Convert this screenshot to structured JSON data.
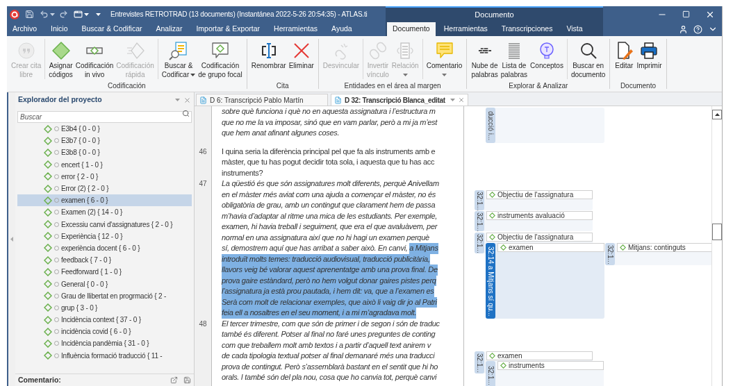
{
  "title_bar": {
    "title": "Entrevistes RETROTRAD (13 documents) (Instantánea 2022-5-26 20:54:35) - ATLAS.ti",
    "context_label": "Documento"
  },
  "menu_tabs": [
    {
      "label": "Archivo",
      "selected": false,
      "kind": "main"
    },
    {
      "label": "Inicio",
      "selected": false,
      "kind": "main"
    },
    {
      "label": "Buscar & Codificar",
      "selected": false,
      "kind": "main"
    },
    {
      "label": "Analizar",
      "selected": false,
      "kind": "main"
    },
    {
      "label": "Importar & Exportar",
      "selected": false,
      "kind": "main"
    },
    {
      "label": "Herramientas",
      "selected": false,
      "kind": "main"
    },
    {
      "label": "Ayuda",
      "selected": false,
      "kind": "main"
    },
    {
      "label": "Documento",
      "selected": true,
      "kind": "context"
    },
    {
      "label": "Herramientas",
      "selected": false,
      "kind": "context"
    },
    {
      "label": "Transcripciones",
      "selected": false,
      "kind": "context"
    },
    {
      "label": "Vista",
      "selected": false,
      "kind": "context"
    }
  ],
  "ribbon": [
    {
      "label": "Codificación",
      "sections": [
        [
          {
            "lines": [
              "Crear cita",
              "libre"
            ],
            "kind": "quote",
            "disabled": true
          }
        ],
        [
          {
            "lines": [
              "Asignar",
              "códigos"
            ],
            "kind": "code",
            "disabled": false
          },
          {
            "lines": [
              "Codificación",
              "in vivo"
            ],
            "kind": "invivo",
            "disabled": false
          },
          {
            "lines": [
              "Codificación",
              "rápida"
            ],
            "kind": "quickcode",
            "disabled": true
          }
        ],
        [
          {
            "lines": [
              "Buscar &",
              "Codificar"
            ],
            "kind": "searchcode",
            "disabled": false,
            "dropdown": true
          },
          {
            "lines": [
              "Codificación",
              "de grupo focal"
            ],
            "kind": "focalgroup",
            "disabled": false
          }
        ]
      ]
    },
    {
      "label": "Cita",
      "sections": [
        [
          {
            "lines": [
              "Renombrar"
            ],
            "kind": "rename",
            "disabled": false
          },
          {
            "lines": [
              "Eliminar"
            ],
            "kind": "delete",
            "disabled": false
          }
        ]
      ]
    },
    {
      "label": "Entidades en el área al margen",
      "sections": [
        [
          {
            "lines": [
              "Desvincular"
            ],
            "kind": "unlink",
            "disabled": true
          }
        ],
        [
          {
            "lines": [
              "Invertir",
              "vínculo"
            ],
            "kind": "invert",
            "disabled": true
          },
          {
            "lines": [
              "Relación"
            ],
            "kind": "relation",
            "disabled": true,
            "dropdown": true
          }
        ],
        [
          {
            "lines": [
              "Comentario"
            ],
            "kind": "comment",
            "disabled": false,
            "dropdown": true
          }
        ]
      ]
    },
    {
      "label": "Explorar & Analizar",
      "sections": [
        [
          {
            "lines": [
              "Nube de",
              "palabras"
            ],
            "kind": "cloud",
            "disabled": false
          },
          {
            "lines": [
              "Lista de",
              "palabras"
            ],
            "kind": "wordlist",
            "disabled": false
          },
          {
            "lines": [
              "Conceptos"
            ],
            "kind": "concepts",
            "disabled": false
          }
        ],
        [
          {
            "lines": [
              "Buscar en",
              "documento"
            ],
            "kind": "search",
            "disabled": false
          }
        ]
      ]
    },
    {
      "label": "Documento",
      "sections": [
        [
          {
            "lines": [
              "Editar"
            ],
            "kind": "edit",
            "disabled": false
          },
          {
            "lines": [
              "Imprimir"
            ],
            "kind": "print",
            "disabled": false
          }
        ]
      ]
    }
  ],
  "project_explorer": {
    "title": "Explorador del proyecto",
    "search": {
      "placeholder": "Buscar"
    },
    "codes": [
      {
        "label": "E3b4 { 0 - 0 }",
        "selected": false
      },
      {
        "label": "E3b7 { 0 - 0 }",
        "selected": false
      },
      {
        "label": "E3b8 { 0 - 0 }",
        "selected": false
      },
      {
        "label": "encert { 1 - 0 }",
        "selected": false
      },
      {
        "label": "error { 2 - 0 }",
        "selected": false
      },
      {
        "label": "Error (2) { 2 - 0 }",
        "selected": false
      },
      {
        "label": "examen { 6 - 0 }",
        "selected": true
      },
      {
        "label": "Examen (2) { 14 - 0 }",
        "selected": false
      },
      {
        "label": "Excessiu canvi d'assignatures { 2 - 0 }",
        "selected": false
      },
      {
        "label": "Experiència { 12 - 0 }",
        "selected": false
      },
      {
        "label": "experiència docent { 6 - 0 }",
        "selected": false
      },
      {
        "label": "feedback { 7 - 0 }",
        "selected": false
      },
      {
        "label": "Feedforward { 1 - 0 }",
        "selected": false
      },
      {
        "label": "General { 0 - 0 }",
        "selected": false
      },
      {
        "label": "Grau de llibertat en progrmació { 2 -",
        "selected": false
      },
      {
        "label": "grup { 3 - 0 }",
        "selected": false
      },
      {
        "label": "Incidència context { 37 - 0 }",
        "selected": false
      },
      {
        "label": "incidència covid { 6 - 0 }",
        "selected": false
      },
      {
        "label": "Incidència pandèmia { 31 - 0 }",
        "selected": false
      },
      {
        "label": "Influència formació traducció { 11 -",
        "selected": false
      }
    ],
    "comment_label": "Comentario:"
  },
  "document_tabs": [
    {
      "label": "D 6: Transcripció Pablo Martín",
      "selected": false
    },
    {
      "label": "D 32: Transcripció Blanca_editat",
      "selected": true
    }
  ],
  "paragraphs": [
    {
      "italic": true,
      "lines": [
        [
          {
            "text": "sobre què funciona i què no en aquesta assignatura i l’estructura m",
            "selected": false
          }
        ],
        [
          {
            "text": "que no me la va imposar, sinó que en vam parlar, però a mi ja m’est",
            "selected": false
          }
        ],
        [
          {
            "text": "que hem anat afinant algunes coses.",
            "selected": false
          }
        ]
      ]
    },
    {
      "number": "46",
      "italic": false,
      "lines": [
        [
          {
            "text": "I quina seria la diferència principal pel que fa als instruments amb e",
            "selected": false
          }
        ],
        [
          {
            "text": "màster, que tu has pogut decidir tota sola, i aquesta que tu has acc",
            "selected": false
          }
        ],
        [
          {
            "text": "instruments?",
            "selected": false
          }
        ]
      ]
    },
    {
      "number": "47",
      "italic": true,
      "lines": [
        [
          {
            "text": "La qüestió és que són assignatures molt diferents, perquè Anivellam",
            "selected": false
          }
        ],
        [
          {
            "text": "en el màster més aviat com una ajuda a començar el màster, no és",
            "selected": false
          }
        ],
        [
          {
            "text": "obligatòria de grau, amb un contingut que clarament hem de passa",
            "selected": false
          }
        ],
        [
          {
            "text": "m’havia d’adaptar al ritme una mica de les estudiants. Per exemple,",
            "selected": false
          }
        ],
        [
          {
            "text": "examen, hi havia treball i seguiment, que era el que avaluàvem, per",
            "selected": false
          }
        ],
        [
          {
            "text": "normal en una assignatura així que no hi hagi un examen perquè",
            "selected": false
          }
        ],
        [
          {
            "text": "sí, demostrem aquí que has arribat a saber això. En canvi, ",
            "selected": false
          },
          {
            "text": "a Mitjans",
            "selected": true
          }
        ],
        [
          {
            "text": "introduït molts temes: traducció audiovisual, traducció publicitària,",
            "selected": true
          }
        ],
        [
          {
            "text": "llavors veig bé valorar aquest aprenentatge amb una prova final. De",
            "selected": true
          }
        ],
        [
          {
            "text": "prova gaire estàndard, però no hem volgut donar gaires pistes perq",
            "selected": true
          }
        ],
        [
          {
            "text": "l’assignatura ja està prou pautada, i hem dit: va, que a l’examen es",
            "selected": true
          }
        ],
        [
          {
            "text": "Serà com molt de relacionar exemples, que això li vaig dir jo al Patri",
            "selected": true
          }
        ],
        [
          {
            "text": "feia ell a nosaltres en el seu moment, i a mi m’agradava molt.",
            "selected": true
          }
        ]
      ]
    },
    {
      "number": "48",
      "italic": true,
      "lines": [
        [
          {
            "text": "El tercer trimestre, com que són de primer i de segon i són de traduc",
            "selected": false
          }
        ],
        [
          {
            "text": "també és diferent. Potser al final no faré unes preguntes de conting",
            "selected": false
          }
        ],
        [
          {
            "text": "com que treballem molt amb textos i a partir d’aquell text anirem v",
            "selected": false
          }
        ],
        [
          {
            "text": "de cada tipologia textual potser al final demanaré més una traducci",
            "selected": false
          }
        ],
        [
          {
            "text": "prova de contingut. Però s’assemblarà bastant en el sentit que hi ho",
            "selected": false
          }
        ],
        [
          {
            "text": "orals. I també són del pla nou, cosa que ho canvia tot, perquè canvi",
            "selected": false
          }
        ]
      ]
    }
  ],
  "margin_quotes": [
    {
      "label": "ducció i...",
      "selected": false
    },
    {
      "label": "32:1...",
      "selected": false,
      "codes": [
        "Objectiu de l'assignatura"
      ]
    },
    {
      "label": "32:1...",
      "selected": false,
      "codes": [
        "instruments avaluació"
      ]
    },
    {
      "label": "32:1...",
      "selected": false,
      "codes": [
        "Objectiu de l'assignatura"
      ]
    },
    {
      "label": "32:14 a Mitjans sí qu...",
      "selected": true,
      "codes": [
        "examen"
      ]
    },
    {
      "label": "32:1...",
      "selected": false,
      "codes": [
        "Mitjans: continguts"
      ]
    },
    {
      "label": "32:1...",
      "selected": false,
      "codes": [
        "examen"
      ]
    },
    {
      "label": "32:1...",
      "selected": false,
      "codes": [
        "instruments"
      ]
    }
  ]
}
